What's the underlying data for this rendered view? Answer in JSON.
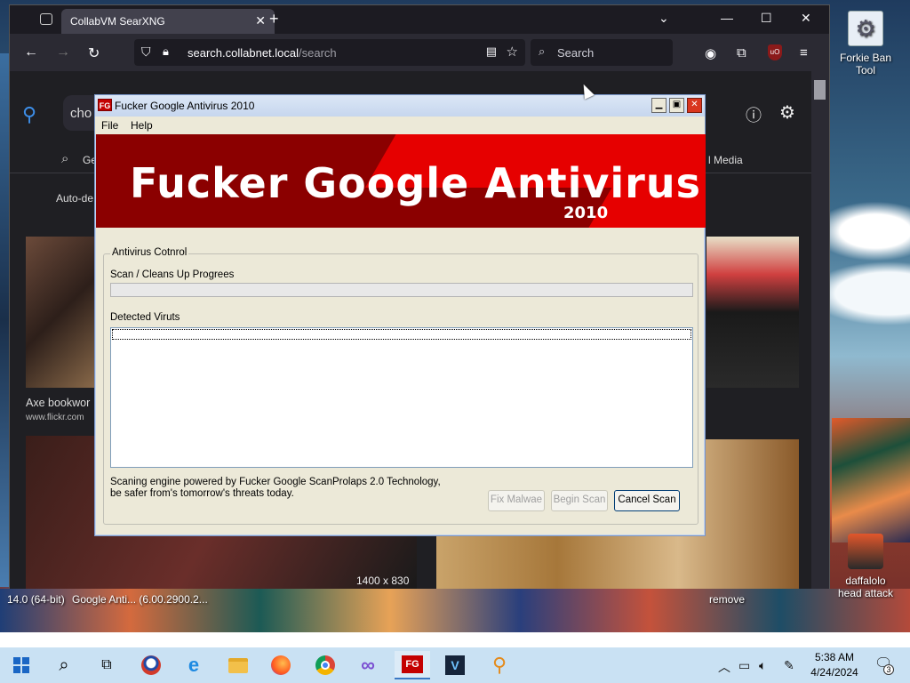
{
  "browser": {
    "tab_title": "CollabVM SearXNG",
    "url_host": "search.collabnet.local",
    "url_path": "/search",
    "search_placeholder": "Search",
    "page_search_text": "cho",
    "page_nav_left": "Ge",
    "page_nav_right": "l Media",
    "page_autodetect": "Auto-de",
    "result_title": "Axe bookwor",
    "result_source": "www.flickr.com",
    "image_dimensions": "1400 x 830"
  },
  "dialog": {
    "title": "Fucker Google Antivirus 2010",
    "menu": [
      "File",
      "Help"
    ],
    "banner_title": "Fucker Google Antivirus",
    "banner_year": "2010",
    "group_label": "Antivirus Cotnrol",
    "progress_label": "Scan / Cleans Up Progrees",
    "progress_value": 0,
    "detected_label": "Detected Viruts",
    "detected_items": [],
    "footer_text": "Scaning engine powered by Fucker Google ScanProlaps 2.0 Technology, be safer from's tomorrow's threats today.",
    "buttons": {
      "fix": "Fix Malwae",
      "begin": "Begin Scan",
      "cancel": "Cancel Scan"
    }
  },
  "desktop": {
    "icons": [
      {
        "label": "Forkie Ban Tool",
        "icon": "gear-window-icon"
      },
      {
        "label": "daffalolo head attack",
        "icon": "masked-figure-icon"
      }
    ],
    "stray_labels": [
      "14.0 (64-bit)",
      "Google Anti... (6.00.2900.2...",
      "remove"
    ]
  },
  "taskbar": {
    "apps": [
      "start-icon",
      "search-icon",
      "task-view-icon",
      "obama-icon",
      "internet-explorer-icon",
      "file-explorer-icon",
      "firefox-icon",
      "chrome-icon",
      "visual-studio-icon",
      "fg-antivirus-icon",
      "vegas-icon",
      "magnifier-icon"
    ],
    "time": "5:38 AM",
    "date": "4/24/2024",
    "notification_count": "3"
  },
  "colors": {
    "banner_dark": "#8b0000",
    "banner_red": "#e60000",
    "taskbar": "#c9e1f3",
    "dialog_bg": "#ece9d8"
  }
}
